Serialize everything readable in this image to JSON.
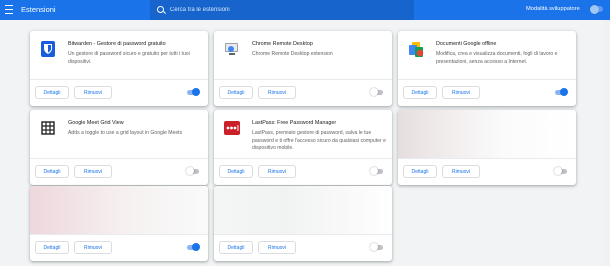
{
  "header": {
    "title": "Estensioni",
    "search_placeholder": "Cerca tra le estensioni",
    "dev_mode_label": "Modalità sviluppatore",
    "dev_mode_on": false
  },
  "buttons": {
    "details": "Dettagli",
    "remove": "Rimuovi"
  },
  "extensions": [
    {
      "name": "Bitwarden - Gestore di password gratuito",
      "description": "Un gestore di password sicuro e gratuito per tutti i tuoi dispositivi.",
      "icon": "bitwarden-icon",
      "enabled": true
    },
    {
      "name": "Chrome Remote Desktop",
      "description": "Chrome Remote Desktop extension",
      "icon": "remote-desktop-icon",
      "enabled": false
    },
    {
      "name": "Documenti Google offline",
      "description": "Modifica, crea e visualizza documenti, fogli di lavoro e presentazioni, senza accesso a Internet.",
      "icon": "google-docs-offline-icon",
      "enabled": true
    },
    {
      "name": "Google Meet Grid View",
      "description": "Adds a toggle to use a grid layout in Google Meets",
      "icon": "grid-icon",
      "enabled": false
    },
    {
      "name": "LastPass: Free Password Manager",
      "description": "LastPass, premiato gestore di password, salva le tue password e ti offre l'accesso sicuro da qualsiasi computer e dispositivo mobile.",
      "icon": "lastpass-icon",
      "enabled": false
    },
    {
      "name": "",
      "description": "",
      "icon": "blurred-icon",
      "enabled": false
    },
    {
      "name": "",
      "description": "",
      "icon": "blurred-icon",
      "enabled": true
    },
    {
      "name": "",
      "description": "",
      "icon": "blurred-icon",
      "enabled": false
    }
  ],
  "colors": {
    "accent": "#1a73e8",
    "background": "#f1f3f4"
  }
}
